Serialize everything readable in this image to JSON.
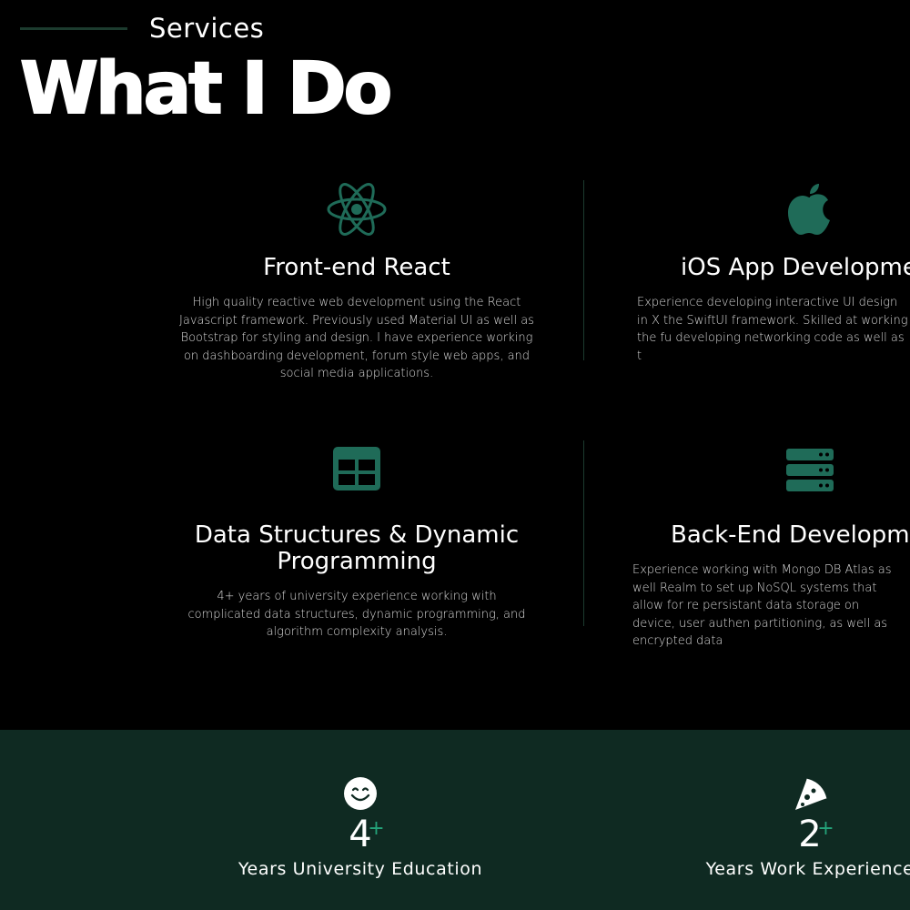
{
  "header": {
    "eyebrow": "Services",
    "title": "What I Do"
  },
  "colors": {
    "accent": "#1f6b58",
    "stats_background": "#0f2a22",
    "plus_accent": "#24a37a",
    "divider": "#1c3b2e"
  },
  "services": [
    {
      "icon": "react-atom-icon",
      "title": "Front-end React",
      "description": "High quality reactive web development using the React Javascript framework. Previously used Material UI as well as Bootstrap for styling and design. I have experience working on dashboarding development, forum style web apps, and social media applications."
    },
    {
      "icon": "apple-logo-icon",
      "title": "iOS App Developme",
      "description": "Experience developing interactive UI design in X the SwiftUI framework. Skilled at working the fu developing networking code as well as t"
    },
    {
      "icon": "table-icon",
      "title": "Data Structures & Dynamic Programming",
      "description": "4+ years of university experience working with complicated data structures, dynamic programming, and algorithm complexity analysis."
    },
    {
      "icon": "server-icon",
      "title": "Back-End Developm",
      "description": "Experience working with Mongo DB Atlas as well Realm to set up NoSQL systems that allow for re persistant data storage on device, user authen partitioning, as well as encrypted data"
    }
  ],
  "stats": [
    {
      "icon": "smiley-face-icon",
      "value": "4",
      "suffix": "+",
      "label": "Years University Education"
    },
    {
      "icon": "pizza-slice-icon",
      "value": "2",
      "suffix": "+",
      "label": "Years Work Experience"
    }
  ]
}
